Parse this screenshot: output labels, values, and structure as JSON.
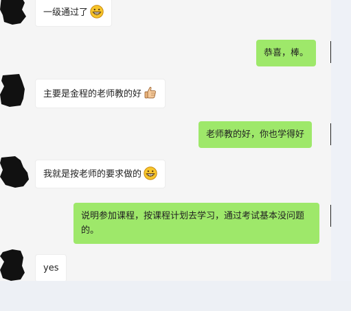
{
  "messages": [
    {
      "side": "in",
      "text": "一级通过了",
      "emoji": "grinning-face"
    },
    {
      "side": "out",
      "text": "恭喜，棒。"
    },
    {
      "side": "in",
      "text": "主要是金程的老师教的好",
      "emoji": "thumbs-up"
    },
    {
      "side": "out",
      "text": "老师教的好，你也学得好"
    },
    {
      "side": "in",
      "text": "我就是按老师的要求做的",
      "emoji": "grinning-face"
    },
    {
      "side": "out",
      "text": "说明参加课程，按课程计划去学习，通过考试基本没问题的。"
    },
    {
      "side": "in",
      "text": "yes"
    }
  ],
  "colors": {
    "outgoing_bubble": "#9ee86a",
    "incoming_bubble": "#ffffff",
    "chat_background": "#f5f5f5"
  }
}
